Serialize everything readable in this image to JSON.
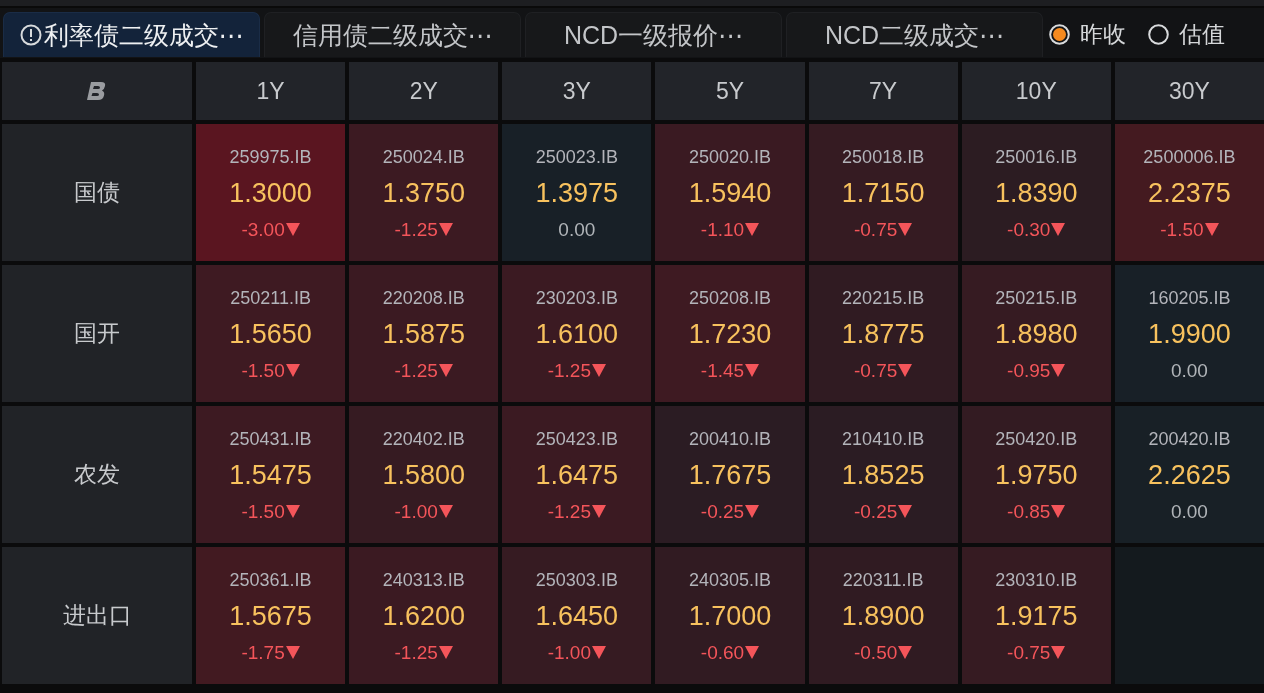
{
  "tabs": [
    {
      "label": "利率债二级成交⋯",
      "selected": true,
      "warning": true
    },
    {
      "label": "信用债二级成交⋯",
      "selected": false,
      "warning": false
    },
    {
      "label": "NCD一级报价⋯",
      "selected": false,
      "warning": false
    },
    {
      "label": "NCD二级成交⋯",
      "selected": false,
      "warning": false
    }
  ],
  "price_mode": [
    {
      "label": "昨收",
      "selected": true
    },
    {
      "label": "估值",
      "selected": false
    }
  ],
  "table": {
    "columns": [
      "1Y",
      "2Y",
      "3Y",
      "5Y",
      "7Y",
      "10Y",
      "30Y"
    ],
    "rows": [
      {
        "label": "国债",
        "cells": [
          {
            "kind": "quote",
            "code": "259975.IB",
            "yield": "1.3000",
            "change": "-3.00",
            "falling": true,
            "color": "#5a1520"
          },
          {
            "kind": "quote",
            "code": "250024.IB",
            "yield": "1.3750",
            "change": "-1.25",
            "falling": true,
            "color": "#3c1a22"
          },
          {
            "kind": "quote",
            "code": "250023.IB",
            "yield": "1.3975",
            "change": "0.00",
            "falling": false,
            "color": "#182027"
          },
          {
            "kind": "quote",
            "code": "250020.IB",
            "yield": "1.5940",
            "change": "-1.10",
            "falling": true,
            "color": "#3a1a22"
          },
          {
            "kind": "quote",
            "code": "250018.IB",
            "yield": "1.7150",
            "change": "-0.75",
            "falling": true,
            "color": "#351b22"
          },
          {
            "kind": "quote",
            "code": "250016.IB",
            "yield": "1.8390",
            "change": "-0.30",
            "falling": true,
            "color": "#2c1c22"
          },
          {
            "kind": "quote",
            "code": "2500006.IB",
            "yield": "2.2375",
            "change": "-1.50",
            "falling": true,
            "color": "#441a20"
          }
        ]
      },
      {
        "label": "国开",
        "cells": [
          {
            "kind": "quote",
            "code": "250211.IB",
            "yield": "1.5650",
            "change": "-1.50",
            "falling": true,
            "color": "#3e1a22"
          },
          {
            "kind": "quote",
            "code": "220208.IB",
            "yield": "1.5875",
            "change": "-1.25",
            "falling": true,
            "color": "#3b1a22"
          },
          {
            "kind": "quote",
            "code": "230203.IB",
            "yield": "1.6100",
            "change": "-1.25",
            "falling": true,
            "color": "#3b1a22"
          },
          {
            "kind": "quote",
            "code": "250208.IB",
            "yield": "1.7230",
            "change": "-1.45",
            "falling": true,
            "color": "#3e1a22"
          },
          {
            "kind": "quote",
            "code": "220215.IB",
            "yield": "1.8775",
            "change": "-0.75",
            "falling": true,
            "color": "#301b22"
          },
          {
            "kind": "quote",
            "code": "250215.IB",
            "yield": "1.8980",
            "change": "-0.95",
            "falling": true,
            "color": "#361b22"
          },
          {
            "kind": "quote",
            "code": "160205.IB",
            "yield": "1.9900",
            "change": "0.00",
            "falling": false,
            "color": "#182027"
          }
        ]
      },
      {
        "label": "农发",
        "cells": [
          {
            "kind": "quote",
            "code": "250431.IB",
            "yield": "1.5475",
            "change": "-1.50",
            "falling": true,
            "color": "#3d1a22"
          },
          {
            "kind": "quote",
            "code": "220402.IB",
            "yield": "1.5800",
            "change": "-1.00",
            "falling": true,
            "color": "#361b22"
          },
          {
            "kind": "quote",
            "code": "250423.IB",
            "yield": "1.6475",
            "change": "-1.25",
            "falling": true,
            "color": "#3b1a22"
          },
          {
            "kind": "quote",
            "code": "200410.IB",
            "yield": "1.7675",
            "change": "-0.25",
            "falling": true,
            "color": "#2b1c23"
          },
          {
            "kind": "quote",
            "code": "210410.IB",
            "yield": "1.8525",
            "change": "-0.25",
            "falling": true,
            "color": "#2b1c23"
          },
          {
            "kind": "quote",
            "code": "250420.IB",
            "yield": "1.9750",
            "change": "-0.85",
            "falling": true,
            "color": "#331b22"
          },
          {
            "kind": "quote",
            "code": "200420.IB",
            "yield": "2.2625",
            "change": "0.00",
            "falling": false,
            "color": "#182026"
          }
        ]
      },
      {
        "label": "进出口",
        "cells": [
          {
            "kind": "quote",
            "code": "250361.IB",
            "yield": "1.5675",
            "change": "-1.75",
            "falling": true,
            "color": "#421a21"
          },
          {
            "kind": "quote",
            "code": "240313.IB",
            "yield": "1.6200",
            "change": "-1.25",
            "falling": true,
            "color": "#3b1a22"
          },
          {
            "kind": "quote",
            "code": "250303.IB",
            "yield": "1.6450",
            "change": "-1.00",
            "falling": true,
            "color": "#361b22"
          },
          {
            "kind": "quote",
            "code": "240305.IB",
            "yield": "1.7000",
            "change": "-0.60",
            "falling": true,
            "color": "#311b22"
          },
          {
            "kind": "quote",
            "code": "220311.IB",
            "yield": "1.8900",
            "change": "-0.50",
            "falling": true,
            "color": "#301b22"
          },
          {
            "kind": "quote",
            "code": "230310.IB",
            "yield": "1.9175",
            "change": "-0.75",
            "falling": true,
            "color": "#361b22"
          },
          {
            "kind": "empty",
            "color": "#141a1e"
          }
        ]
      }
    ]
  }
}
